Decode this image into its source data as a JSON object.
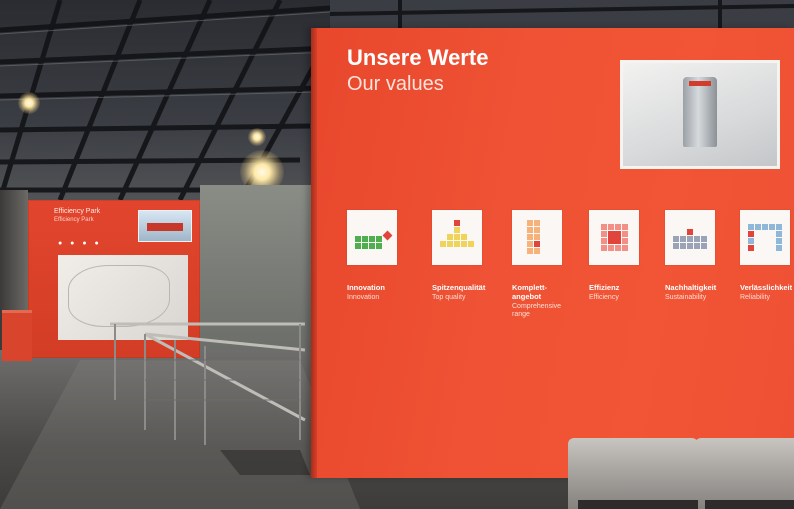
{
  "main_panel": {
    "title": "Unsere Werte",
    "subtitle": "Our values",
    "values": [
      {
        "de": "Innovation",
        "en": "Innovation",
        "icon": "innovation-icon"
      },
      {
        "de": "Spitzenqualität",
        "en": "Top quality",
        "icon": "top-quality-icon"
      },
      {
        "de": "Komplett-\nangebot",
        "en": "Comprehensive\nrange",
        "icon": "comprehensive-range-icon"
      },
      {
        "de": "Effizienz",
        "en": "Efficiency",
        "icon": "efficiency-icon"
      },
      {
        "de": "Nachhaltigkeit",
        "en": "Sustainability",
        "icon": "sustainability-icon"
      },
      {
        "de": "Verlässlichkeit",
        "en": "Reliability",
        "icon": "reliability-icon"
      }
    ]
  },
  "rear_panel": {
    "title": "Efficiency Park",
    "subtitle": "Efficiency Park"
  },
  "colors": {
    "panel_red": "#ef5234",
    "tile_white": "#fbf7f5"
  }
}
